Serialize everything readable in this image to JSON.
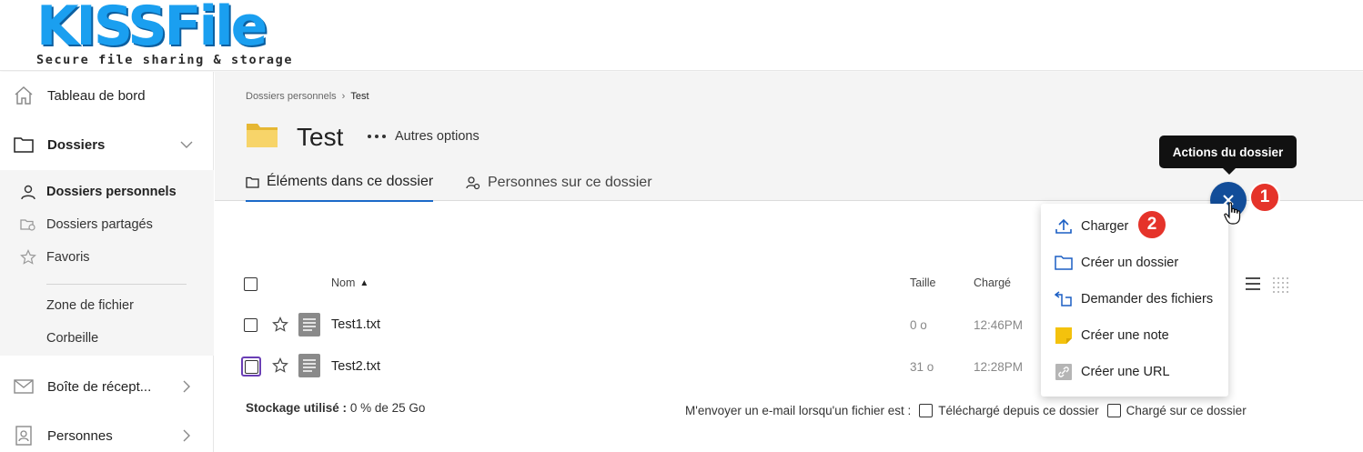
{
  "brand": {
    "logo_text": "KISSFile",
    "tagline": "Secure file sharing & storage",
    "color_primary": "#1a9ff0",
    "color_accent": "#124d99"
  },
  "sidebar": {
    "items": [
      {
        "label": "Tableau de bord",
        "icon": "home-icon"
      },
      {
        "label": "Dossiers",
        "icon": "folder-icon",
        "expanded": true
      },
      {
        "label": "Boîte de récept...",
        "icon": "mail-icon"
      },
      {
        "label": "Personnes",
        "icon": "person-card-icon"
      }
    ],
    "sub_items": [
      {
        "label": "Dossiers personnels",
        "icon": "person-icon",
        "active": true
      },
      {
        "label": "Dossiers partagés",
        "icon": "shared-folder-icon"
      },
      {
        "label": "Favoris",
        "icon": "star-icon"
      },
      {
        "label": "Zone de fichier",
        "icon": ""
      },
      {
        "label": "Corbeille",
        "icon": ""
      }
    ]
  },
  "breadcrumb": {
    "parent": "Dossiers personnels",
    "separator": "›",
    "current": "Test"
  },
  "page": {
    "title": "Test",
    "more_options": "Autres options"
  },
  "tabs": [
    {
      "label": "Éléments dans ce dossier",
      "active": true,
      "icon": "folder-outline-icon"
    },
    {
      "label": "Personnes sur ce dossier",
      "active": false,
      "icon": "people-settings-icon"
    }
  ],
  "table": {
    "headers": {
      "name": "Nom",
      "name_sort": "▲",
      "size": "Taille",
      "uploaded": "Chargé"
    },
    "rows": [
      {
        "name": "Test1.txt",
        "size": "0 o",
        "uploaded": "12:46PM"
      },
      {
        "name": "Test2.txt",
        "size": "31 o",
        "uploaded": "12:28PM"
      }
    ]
  },
  "footer": {
    "storage_label": "Stockage utilisé :",
    "storage_value": "0 % de 25 Go",
    "notify_label": "M'envoyer un e-mail lorsqu'un fichier est :",
    "notify_downloaded": "Téléchargé depuis ce dossier",
    "notify_uploaded": "Chargé sur ce dossier"
  },
  "folder_actions": {
    "tooltip": "Actions du dossier",
    "badge_1": "1",
    "badge_2": "2",
    "menu": [
      {
        "label": "Charger",
        "icon": "upload-icon"
      },
      {
        "label": "Créer un dossier",
        "icon": "new-folder-icon"
      },
      {
        "label": "Demander des fichiers",
        "icon": "request-files-icon"
      },
      {
        "label": "Créer une note",
        "icon": "note-icon"
      },
      {
        "label": "Créer une URL",
        "icon": "url-link-icon"
      }
    ]
  }
}
